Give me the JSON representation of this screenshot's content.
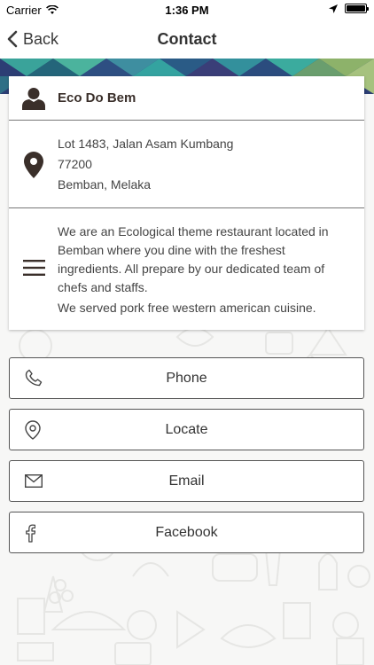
{
  "status_bar": {
    "carrier": "Carrier",
    "time": "1:36 PM"
  },
  "nav": {
    "back_label": "Back",
    "title": "Contact"
  },
  "info": {
    "name": "Eco Do Bem",
    "address": {
      "line1": "Lot 1483, Jalan Asam Kumbang",
      "line2": "77200",
      "line3": "Bemban, Melaka"
    },
    "description": {
      "paragraph1": "We are an Ecological theme restaurant located in Bemban where you dine with the freshest ingredients. All prepare by our dedicated team of chefs and staffs.",
      "paragraph2": "We served pork free western american cuisine."
    }
  },
  "actions": {
    "phone": "Phone",
    "locate": "Locate",
    "email": "Email",
    "facebook": "Facebook"
  },
  "colors": {
    "banner_teal": "#3aa39a",
    "banner_navy": "#2c3e74",
    "banner_olive": "#8db26a",
    "icon_brown": "#3a2f2a",
    "border_dark": "#555555"
  }
}
